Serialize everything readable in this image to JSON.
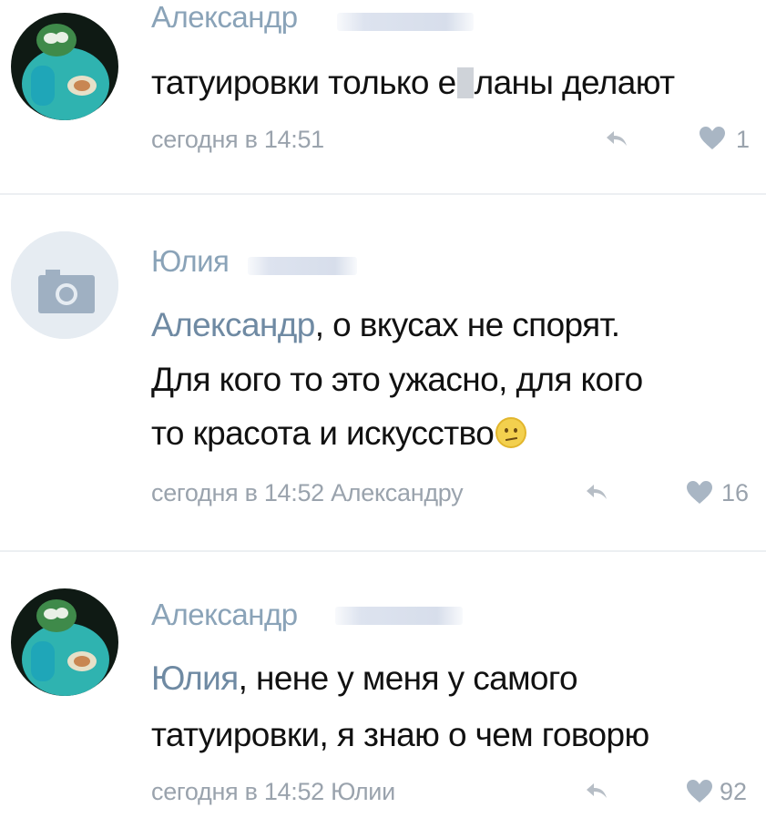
{
  "comments": [
    {
      "author": "Александр",
      "text_before_censor": "татуировки только е",
      "text_after_censor": "ланы делают",
      "time": "сегодня в 14:51",
      "likes": "1"
    },
    {
      "author": "Юлия",
      "mention": "Александр",
      "line1_rest": ", о вкусах не спорят.",
      "line2": "Для кого то это ужасно,  для кого",
      "line3": "то красота и искусство",
      "time": "сегодня в 14:52 Александру",
      "likes": "16"
    },
    {
      "author": "Александр",
      "mention": "Юлия",
      "line1_rest": ", нене у меня у самого",
      "line2": "татуировки, я знаю о чем говорю",
      "time": "сегодня в 14:52 Юлии",
      "likes": "92"
    }
  ],
  "colors": {
    "name": "#8aa3b8",
    "mention": "#6f8aa3",
    "meta": "#9aa3ad",
    "text": "#111111"
  },
  "icons": {
    "reply": "reply-arrow-icon",
    "like": "heart-icon",
    "avatar_placeholder": "camera-icon",
    "emoji": "confused-face-emoji"
  }
}
